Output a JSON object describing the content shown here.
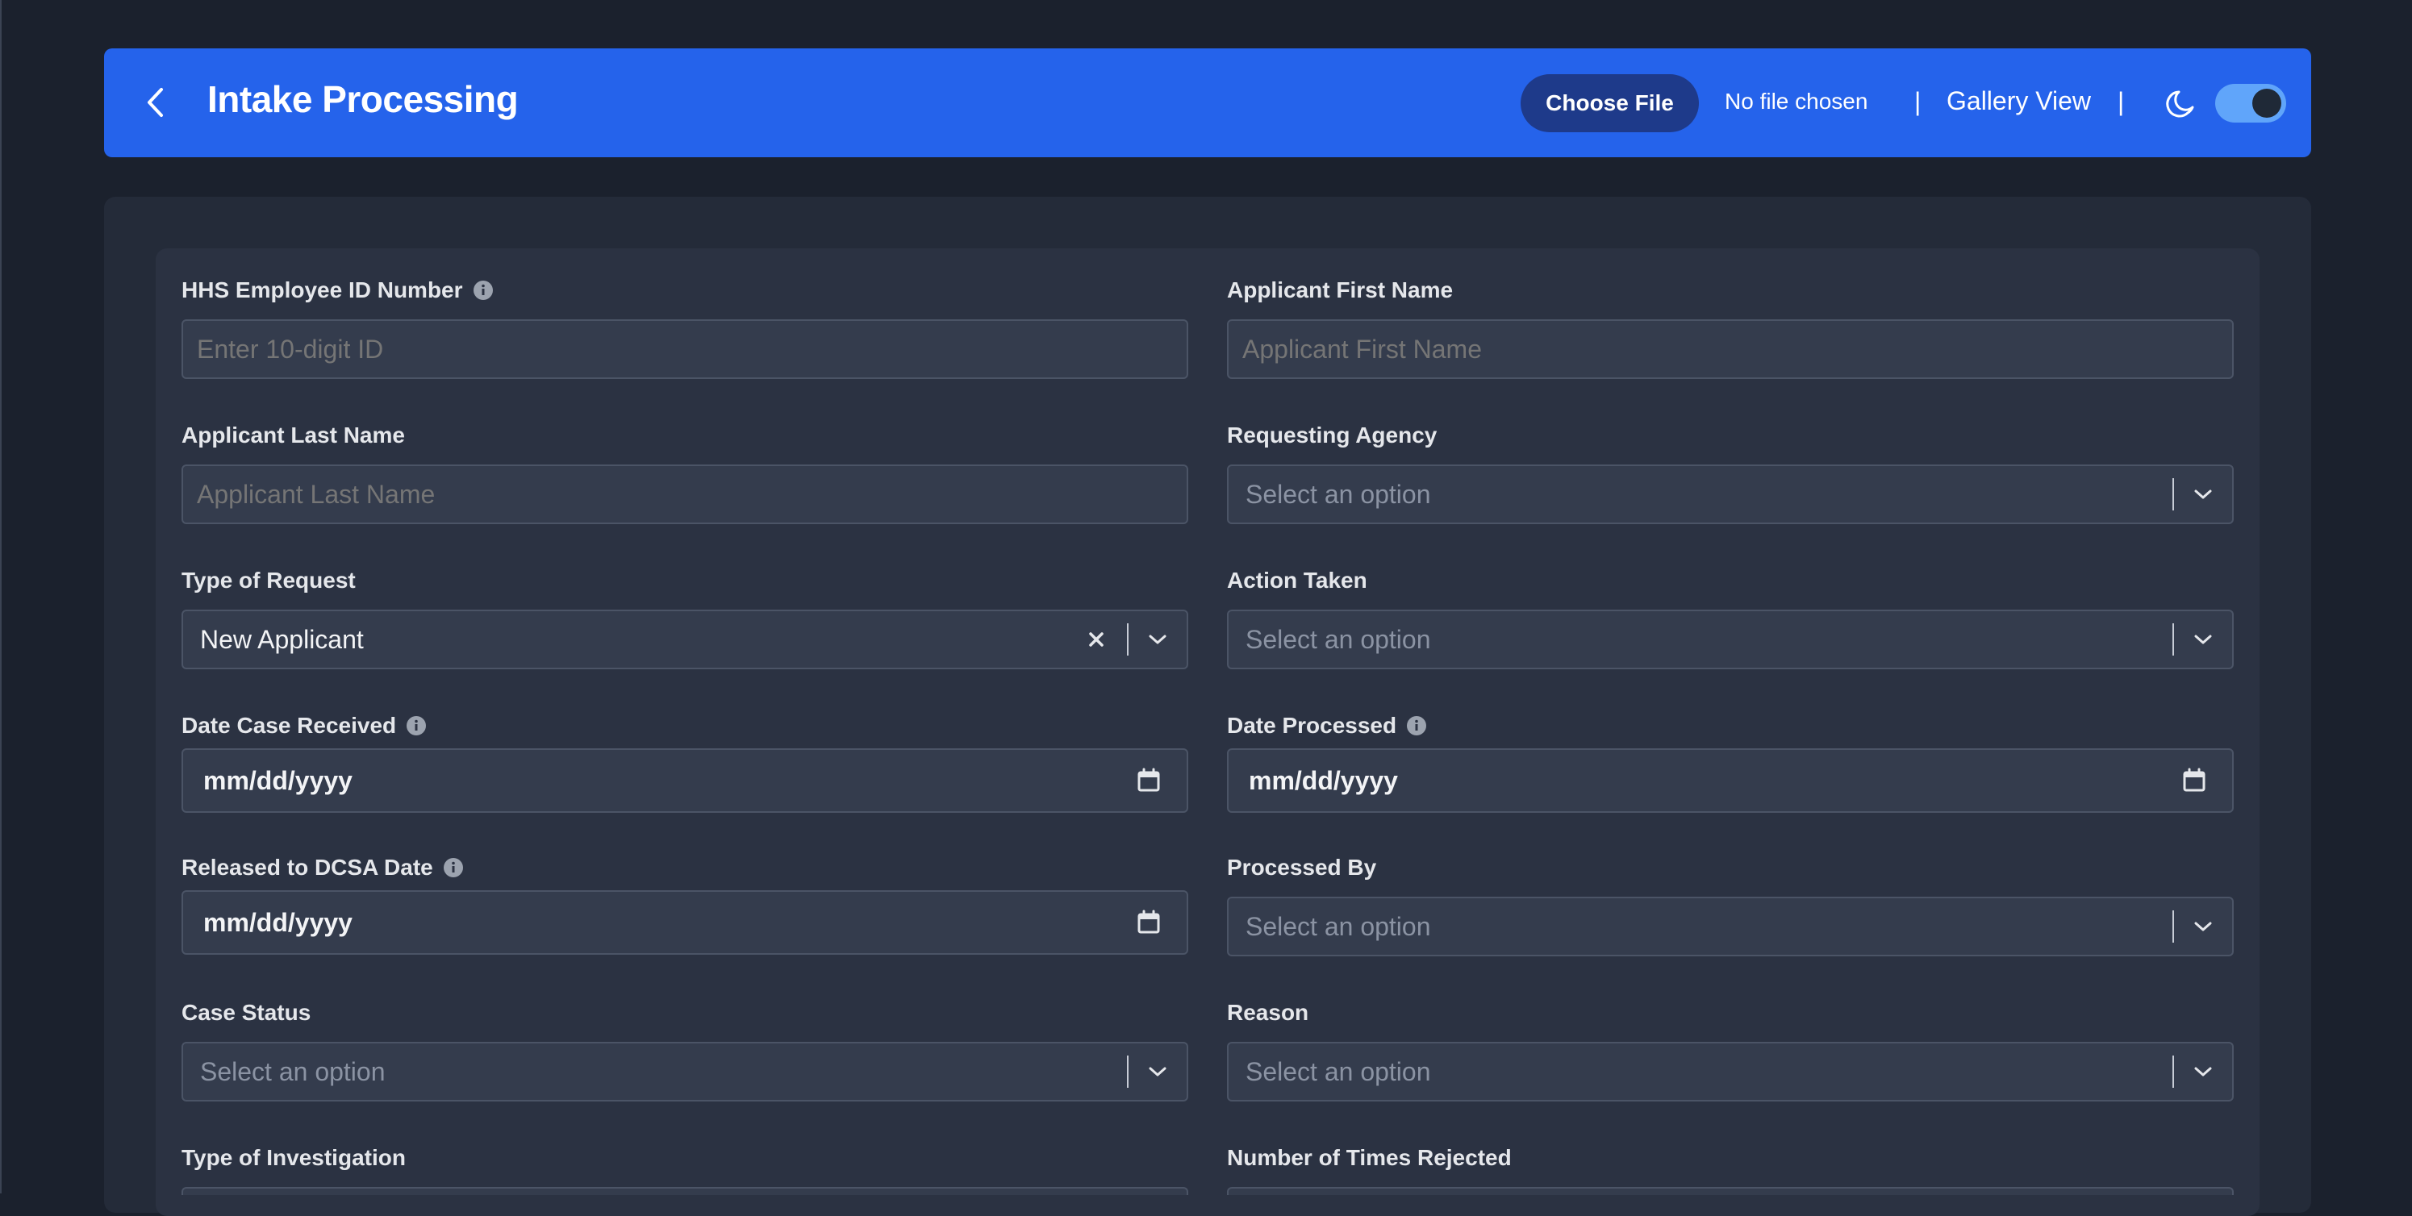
{
  "header": {
    "title": "Intake Processing",
    "choose_file_label": "Choose File",
    "file_status": "No file chosen",
    "separator": "|",
    "gallery_view_label": "Gallery View",
    "dark_mode_enabled": true
  },
  "colors": {
    "page_background": "#1b212d",
    "header_blue": "#2563eb",
    "choose_file_button": "#1e3a8a",
    "panel": "#242b39",
    "inner_panel": "#2b3242",
    "field_background": "#343c4d"
  },
  "form": {
    "hhs_employee_id": {
      "label": "HHS Employee ID Number",
      "placeholder": "Enter 10-digit ID",
      "has_info_icon": true
    },
    "applicant_first_name": {
      "label": "Applicant First Name",
      "placeholder": "Applicant First Name"
    },
    "applicant_last_name": {
      "label": "Applicant Last Name",
      "placeholder": "Applicant Last Name"
    },
    "requesting_agency": {
      "label": "Requesting Agency",
      "placeholder": "Select an option"
    },
    "type_of_request": {
      "label": "Type of Request",
      "value": "New Applicant"
    },
    "action_taken": {
      "label": "Action Taken",
      "placeholder": "Select an option"
    },
    "date_case_received": {
      "label": "Date Case Received",
      "value": "mm/dd/yyyy",
      "has_info_icon": true
    },
    "date_processed": {
      "label": "Date Processed",
      "value": "mm/dd/yyyy",
      "has_info_icon": true
    },
    "released_to_dcsa_date": {
      "label": "Released to DCSA Date",
      "value": "mm/dd/yyyy",
      "has_info_icon": true
    },
    "processed_by": {
      "label": "Processed By",
      "placeholder": "Select an option"
    },
    "case_status": {
      "label": "Case Status",
      "placeholder": "Select an option"
    },
    "reason": {
      "label": "Reason",
      "placeholder": "Select an option"
    },
    "type_of_investigation": {
      "label": "Type of Investigation"
    },
    "number_of_times_rejected": {
      "label": "Number of Times Rejected"
    }
  },
  "icons": {
    "back": "chevron-left-icon",
    "info": "info-icon",
    "clear": "close-icon",
    "dropdown": "chevron-down-icon",
    "calendar": "calendar-icon",
    "theme": "moon-icon"
  }
}
